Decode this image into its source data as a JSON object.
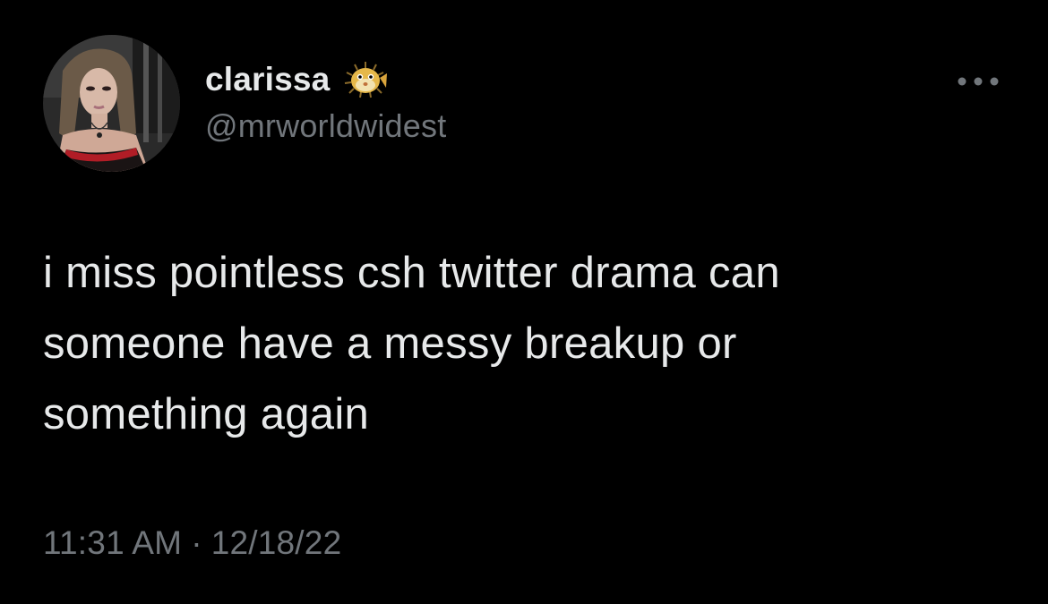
{
  "tweet": {
    "author": {
      "display_name": "clarissa",
      "handle": "@mrworldwidest",
      "name_emoji": "blowfish-icon",
      "avatar": "profile-photo"
    },
    "menu_icon": "more-horizontal-icon",
    "text_lines": [
      "i miss pointless csh twitter drama can",
      "someone have a messy breakup or",
      "something again"
    ],
    "time": "11:31 AM",
    "separator": "·",
    "date": "12/18/22"
  },
  "colors": {
    "background": "#000000",
    "primary_text": "#e7e9ea",
    "secondary_text": "#71767b"
  }
}
